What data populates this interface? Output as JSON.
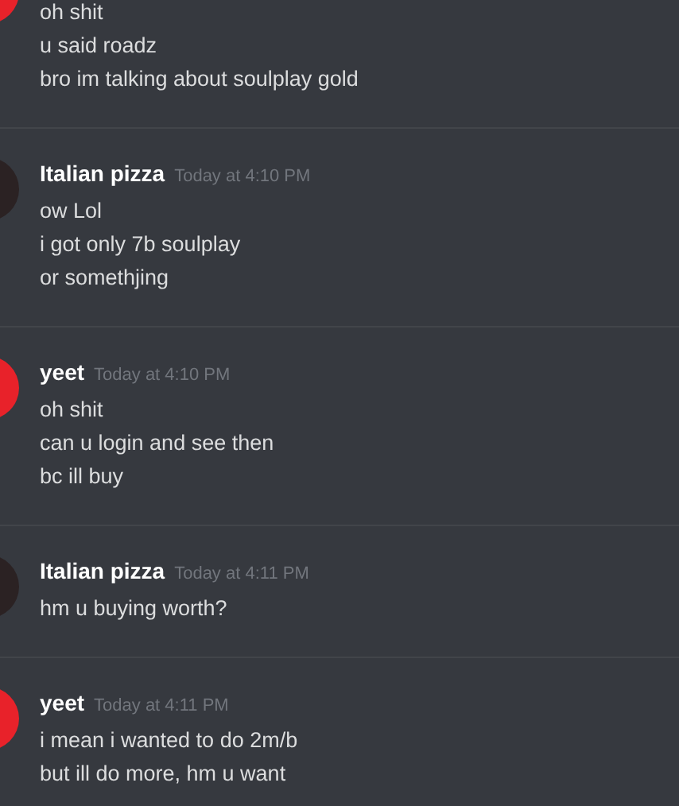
{
  "messages": [
    {
      "color": "#e8222a",
      "lines": [
        "oh shit",
        "u said roadz",
        "bro im talking about soulplay gold"
      ]
    },
    {
      "color": "#2b2223",
      "author": "Italian pizza",
      "timestamp": "Today at 4:10 PM",
      "lines": [
        "ow Lol",
        "i got only 7b soulplay",
        "or somethjing"
      ]
    },
    {
      "color": "#e8222a",
      "author": "yeet",
      "timestamp": "Today at 4:10 PM",
      "lines": [
        "oh shit",
        "can u login and see then",
        "bc ill buy"
      ]
    },
    {
      "color": "#2b2223",
      "author": "Italian pizza",
      "timestamp": "Today at 4:11 PM",
      "lines": [
        "hm u buying worth?"
      ]
    },
    {
      "color": "#e8222a",
      "author": "yeet",
      "timestamp": "Today at 4:11 PM",
      "lines": [
        "i mean i wanted to do 2m/b",
        "but ill do more, hm u want"
      ]
    }
  ]
}
